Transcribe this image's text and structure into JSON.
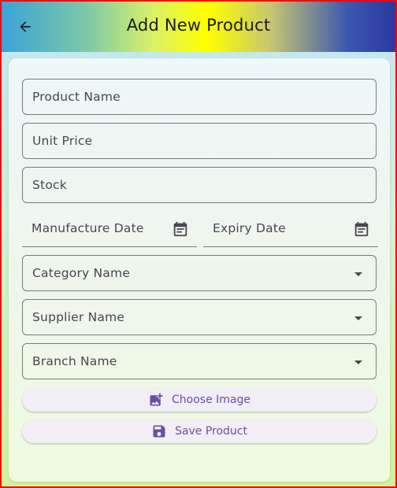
{
  "appbar": {
    "title": "Add New Product",
    "back_icon": "arrow-back-icon"
  },
  "form": {
    "product_name": {
      "label": "Product Name"
    },
    "unit_price": {
      "label": "Unit Price"
    },
    "stock": {
      "label": "Stock"
    },
    "manufacture_date": {
      "label": "Manufacture Date",
      "icon": "calendar-icon"
    },
    "expiry_date": {
      "label": "Expiry Date",
      "icon": "calendar-icon"
    },
    "category": {
      "label": "Category Name",
      "icon": "dropdown-arrow-icon"
    },
    "supplier": {
      "label": "Supplier Name",
      "icon": "dropdown-arrow-icon"
    },
    "branch": {
      "label": "Branch Name",
      "icon": "dropdown-arrow-icon"
    }
  },
  "buttons": {
    "choose_image": {
      "label": "Choose Image",
      "icon": "add-photo-icon"
    },
    "save_product": {
      "label": "Save Product",
      "icon": "save-icon"
    }
  },
  "colors": {
    "accent": "#6750a4",
    "border": "#7a7a7a",
    "frame_border": "#ff0000"
  }
}
